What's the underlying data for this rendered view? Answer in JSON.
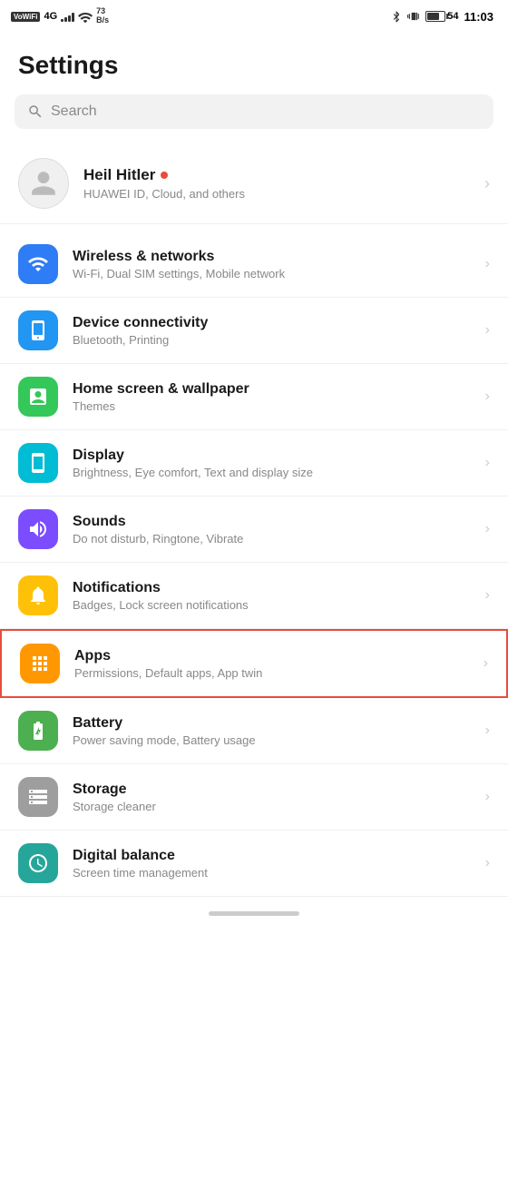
{
  "statusBar": {
    "left": {
      "vowifi": "VoWiFi",
      "signal": "4G",
      "speed": "73\nB/s"
    },
    "right": {
      "bluetooth": "bluetooth",
      "battery": "54",
      "time": "11:03"
    }
  },
  "pageTitle": "Settings",
  "search": {
    "placeholder": "Search"
  },
  "profile": {
    "name": "Heil Hitler",
    "badge": "online",
    "subtitle": "HUAWEI ID, Cloud, and others"
  },
  "settingsItems": [
    {
      "id": "wireless",
      "iconColor": "icon-blue",
      "iconType": "wifi",
      "title": "Wireless & networks",
      "subtitle": "Wi-Fi, Dual SIM settings, Mobile network",
      "highlighted": false
    },
    {
      "id": "device",
      "iconColor": "icon-blue2",
      "iconType": "device",
      "title": "Device connectivity",
      "subtitle": "Bluetooth, Printing",
      "highlighted": false
    },
    {
      "id": "homescreen",
      "iconColor": "icon-green",
      "iconType": "homescreen",
      "title": "Home screen & wallpaper",
      "subtitle": "Themes",
      "highlighted": false
    },
    {
      "id": "display",
      "iconColor": "icon-teal",
      "iconType": "display",
      "title": "Display",
      "subtitle": "Brightness, Eye comfort, Text and display size",
      "highlighted": false
    },
    {
      "id": "sounds",
      "iconColor": "icon-purple",
      "iconType": "sound",
      "title": "Sounds",
      "subtitle": "Do not disturb, Ringtone, Vibrate",
      "highlighted": false
    },
    {
      "id": "notifications",
      "iconColor": "icon-yellow",
      "iconType": "bell",
      "title": "Notifications",
      "subtitle": "Badges, Lock screen notifications",
      "highlighted": false
    },
    {
      "id": "apps",
      "iconColor": "icon-orange",
      "iconType": "apps",
      "title": "Apps",
      "subtitle": "Permissions, Default apps, App twin",
      "highlighted": true
    },
    {
      "id": "battery",
      "iconColor": "icon-green2",
      "iconType": "battery",
      "title": "Battery",
      "subtitle": "Power saving mode, Battery usage",
      "highlighted": false
    },
    {
      "id": "storage",
      "iconColor": "icon-gray",
      "iconType": "storage",
      "title": "Storage",
      "subtitle": "Storage cleaner",
      "highlighted": false
    },
    {
      "id": "digital",
      "iconColor": "icon-teal2",
      "iconType": "digital",
      "title": "Digital balance",
      "subtitle": "Screen time management",
      "highlighted": false
    }
  ]
}
